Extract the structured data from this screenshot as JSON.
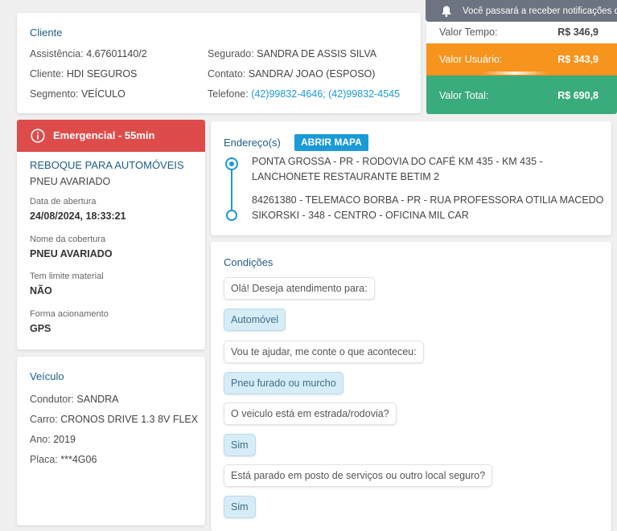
{
  "toast": {
    "text": "Você passará a receber notificações d"
  },
  "cliente": {
    "title": "Cliente",
    "assistencia_label": "Assistência:",
    "assistencia_value": "4.67601140/2",
    "cliente_label": "Cliente:",
    "cliente_value": "HDI SEGUROS",
    "segmento_label": "Segmento:",
    "segmento_value": "VEÍCULO",
    "segurado_label": "Segurado:",
    "segurado_value": "SANDRA DE ASSIS SILVA",
    "contato_label": "Contato:",
    "contato_value": "SANDRA/ JOAO (ESPOSO)",
    "telefone_label": "Telefone:",
    "telefone_value": "(42)99832-4646; (42)99832-4545"
  },
  "valores": {
    "tempo_label": "Valor Tempo:",
    "tempo_value": "R$ 346,9",
    "usuario_label": "Valor Usuário:",
    "usuario_value": "R$ 343,9",
    "total_label": "Valor Total:",
    "total_value": "R$ 690,8",
    "usuario_color": "#f7941d",
    "total_color": "#3aab7b"
  },
  "status": {
    "label": "Emergencial - 55min",
    "color": "#de4b4b"
  },
  "servico": {
    "title": "REBOQUE PARA AUTOMÓVEIS",
    "subtitle": "PNEU AVARIADO",
    "data_label": "Data de abertura",
    "data_value": "24/08/2024, 18:33:21",
    "cobertura_label": "Nome da cobertura",
    "cobertura_value": "PNEU AVARIADO",
    "limite_label": "Tem limite material",
    "limite_value": "NÃO",
    "forma_label": "Forma acionamento",
    "forma_value": "GPS"
  },
  "veiculo": {
    "title": "Veículo",
    "condutor_label": "Condutor:",
    "condutor_value": "SANDRA",
    "carro_label": "Carro:",
    "carro_value": "CRONOS DRIVE 1.3 8V FLEX",
    "ano_label": "Ano:",
    "ano_value": "2019",
    "placa_label": "Placa:",
    "placa_value": "***4G06"
  },
  "endereco": {
    "title": "Endereço(s)",
    "map_button": "ABRIR MAPA",
    "origem_line1": "PONTA GROSSA - PR - RODOVIA DO CAFÉ KM 435 - KM 435 -",
    "origem_line2": "LANCHONETE RESTAURANTE BETIM 2",
    "destino_line1": "84261380 - TELEMACO BORBA - PR - RUA PROFESSORA OTILIA MACEDO",
    "destino_line2": "SIKORSKI - 348 - CENTRO - OFICINA MIL CAR"
  },
  "condicoes": {
    "title": "Condições",
    "messages": [
      {
        "text": "Olá! Deseja atendimento para:",
        "type": "question"
      },
      {
        "text": "Automóvel",
        "type": "answer"
      },
      {
        "text": "Vou te ajudar, me conte o que aconteceu:",
        "type": "question"
      },
      {
        "text": "Pneu furado ou murcho",
        "type": "answer"
      },
      {
        "text": "O veiculo está em estrada/rodovia?",
        "type": "question"
      },
      {
        "text": "Sim",
        "type": "answer"
      },
      {
        "text": "Está parado em posto de serviços ou outro local seguro?",
        "type": "question"
      },
      {
        "text": "Sim",
        "type": "answer"
      }
    ]
  }
}
